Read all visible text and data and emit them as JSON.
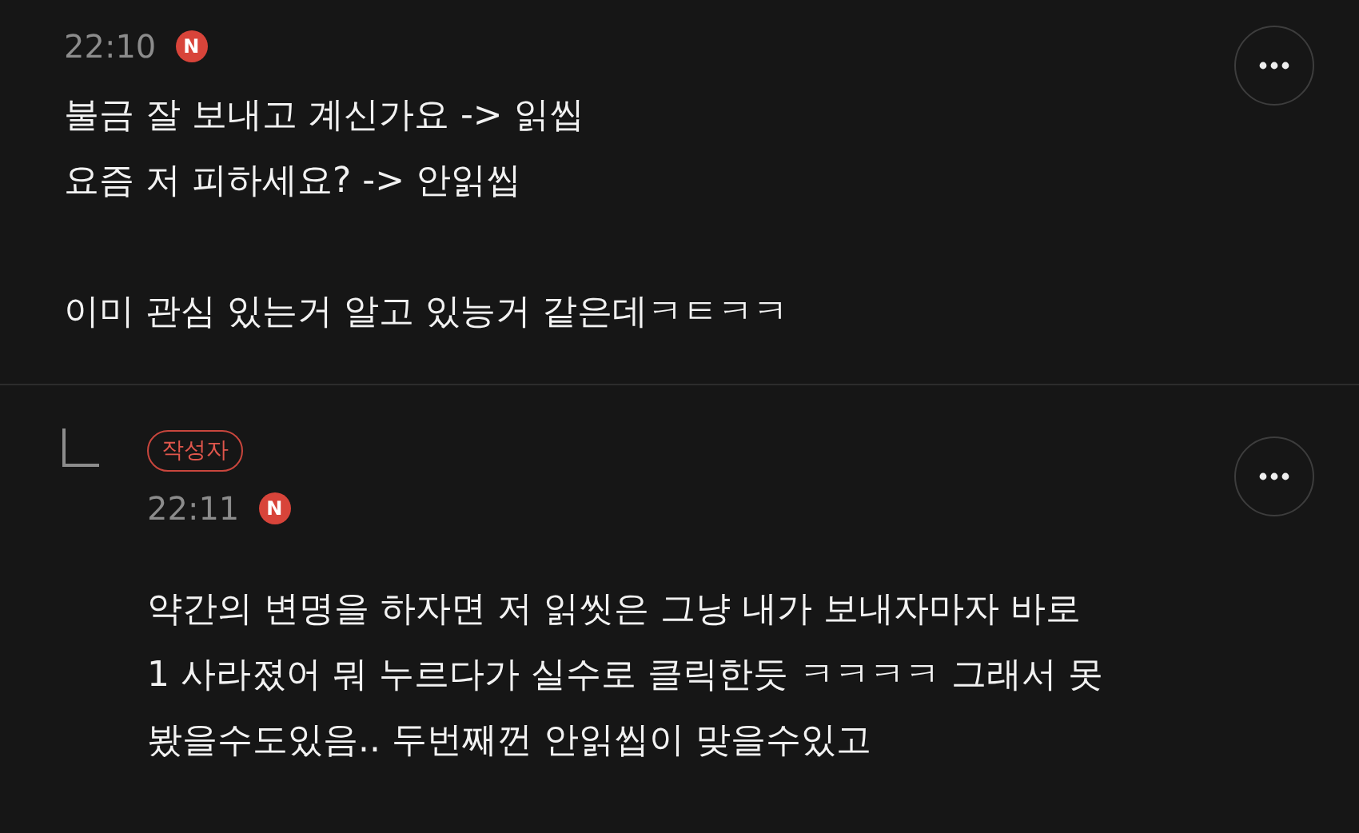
{
  "comments": [
    {
      "kind": "comment",
      "time": "22:10",
      "new_badge": "N",
      "paragraphs": [
        [
          "불금 잘 보내고 계신가요 -> 읽씹",
          "요즘 저 피하세요? -> 안읽씹"
        ],
        [
          "이미 관심 있는거 알고 있능거 같은데ㅋㅌㅋㅋ"
        ]
      ]
    },
    {
      "kind": "reply",
      "author_badge": "작성자",
      "time": "22:11",
      "new_badge": "N",
      "paragraphs": [
        [
          "약간의 변명을 하자면 저 읽씻은 그냥 내가 보내자마자 바로",
          "1 사라졌어 뭐 누르다가 실수로 클릭한듯 ㅋㅋㅋㅋ 그래서 못",
          "봤을수도있음.. 두번째껀 안읽씹이 맞을수있고"
        ]
      ]
    }
  ]
}
